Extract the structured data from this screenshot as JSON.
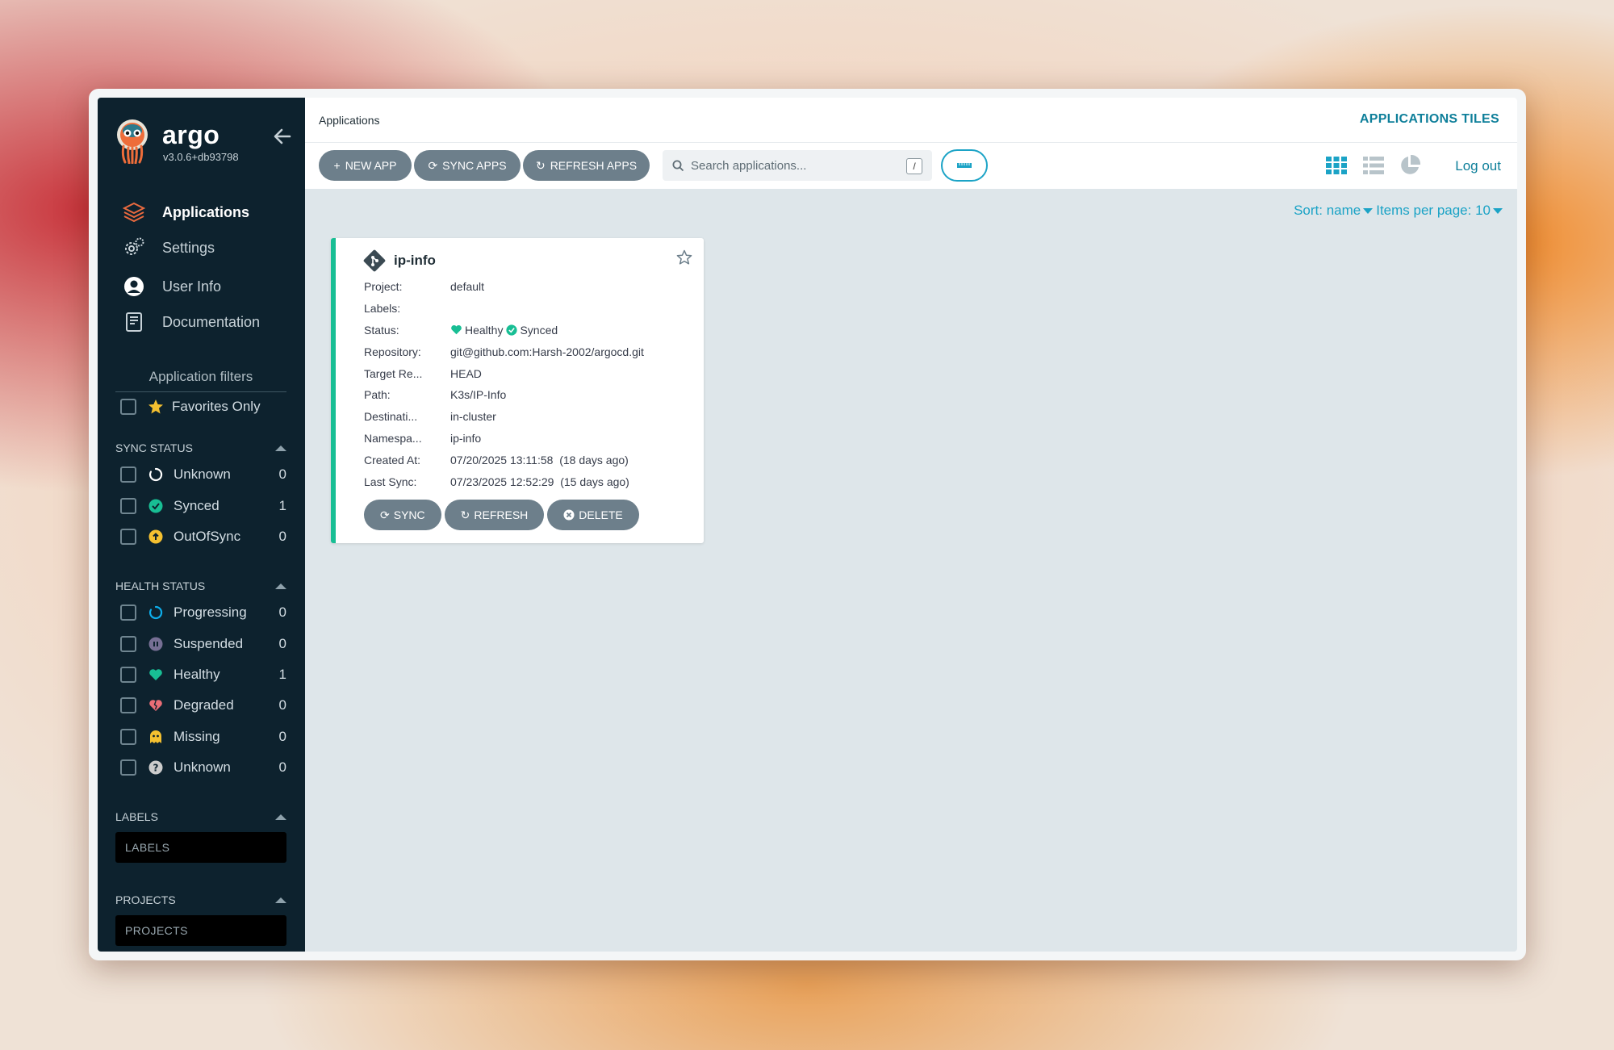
{
  "brand": {
    "name": "argo",
    "version": "v3.0.6+db93798"
  },
  "nav": [
    {
      "label": "Applications",
      "icon": "layers-icon",
      "active": true
    },
    {
      "label": "Settings",
      "icon": "gears-icon",
      "active": false
    },
    {
      "label": "User Info",
      "icon": "user-circle-icon",
      "active": false
    },
    {
      "label": "Documentation",
      "icon": "book-icon",
      "active": false
    }
  ],
  "filters": {
    "title": "Application filters",
    "favorites_label": "Favorites Only",
    "sync_status": {
      "title": "SYNC STATUS",
      "items": [
        {
          "label": "Unknown",
          "count": "0",
          "icon": "circle-notch-icon",
          "color": "#ffffff"
        },
        {
          "label": "Synced",
          "count": "1",
          "icon": "check-circle-icon",
          "color": "#18be94"
        },
        {
          "label": "OutOfSync",
          "count": "0",
          "icon": "arrow-up-circle-icon",
          "color": "#f4c030"
        }
      ]
    },
    "health_status": {
      "title": "HEALTH STATUS",
      "items": [
        {
          "label": "Progressing",
          "count": "0",
          "icon": "spinner-icon",
          "color": "#0dadea"
        },
        {
          "label": "Suspended",
          "count": "0",
          "icon": "pause-circle-icon",
          "color": "#766f94"
        },
        {
          "label": "Healthy",
          "count": "1",
          "icon": "heart-icon",
          "color": "#18be94"
        },
        {
          "label": "Degraded",
          "count": "0",
          "icon": "heart-broken-icon",
          "color": "#e96d76"
        },
        {
          "label": "Missing",
          "count": "0",
          "icon": "ghost-icon",
          "color": "#f4c030"
        },
        {
          "label": "Unknown",
          "count": "0",
          "icon": "question-circle-icon",
          "color": "#cccccc"
        }
      ]
    },
    "labels": {
      "title": "LABELS",
      "placeholder": "LABELS"
    },
    "projects": {
      "title": "PROJECTS",
      "placeholder": "PROJECTS"
    }
  },
  "header": {
    "breadcrumb": "Applications",
    "title": "APPLICATIONS TILES"
  },
  "toolbar": {
    "new_app": "NEW APP",
    "sync_apps": "SYNC APPS",
    "refresh_apps": "REFRESH APPS",
    "search_placeholder": "Search applications...",
    "search_shortcut": "/",
    "logout": "Log out"
  },
  "sort": {
    "sort_label": "Sort: name",
    "per_page_label": "Items per page: 10"
  },
  "app": {
    "name": "ip-info",
    "status_color": "#18be94",
    "props": [
      {
        "key": "Project:",
        "value": "default"
      },
      {
        "key": "Labels:",
        "value": ""
      },
      {
        "key": "Status:",
        "health": "Healthy",
        "sync": "Synced"
      },
      {
        "key": "Repository:",
        "value": "git@github.com:Harsh-2002/argocd.git"
      },
      {
        "key": "Target Re...",
        "value": "HEAD"
      },
      {
        "key": "Path:",
        "value": "K3s/IP-Info"
      },
      {
        "key": "Destinati...",
        "value": "in-cluster"
      },
      {
        "key": "Namespa...",
        "value": "ip-info"
      },
      {
        "key": "Created At:",
        "value": "07/20/2025 13:11:58  (18 days ago)"
      },
      {
        "key": "Last Sync:",
        "value": "07/23/2025 12:52:29  (15 days ago)"
      }
    ],
    "actions": {
      "sync": "SYNC",
      "refresh": "REFRESH",
      "delete": "DELETE"
    }
  },
  "colors": {
    "accent": "#1ba3c6",
    "title": "#0e7f9a",
    "sidebar": "#0d222e",
    "button": "#6d7f8b"
  }
}
